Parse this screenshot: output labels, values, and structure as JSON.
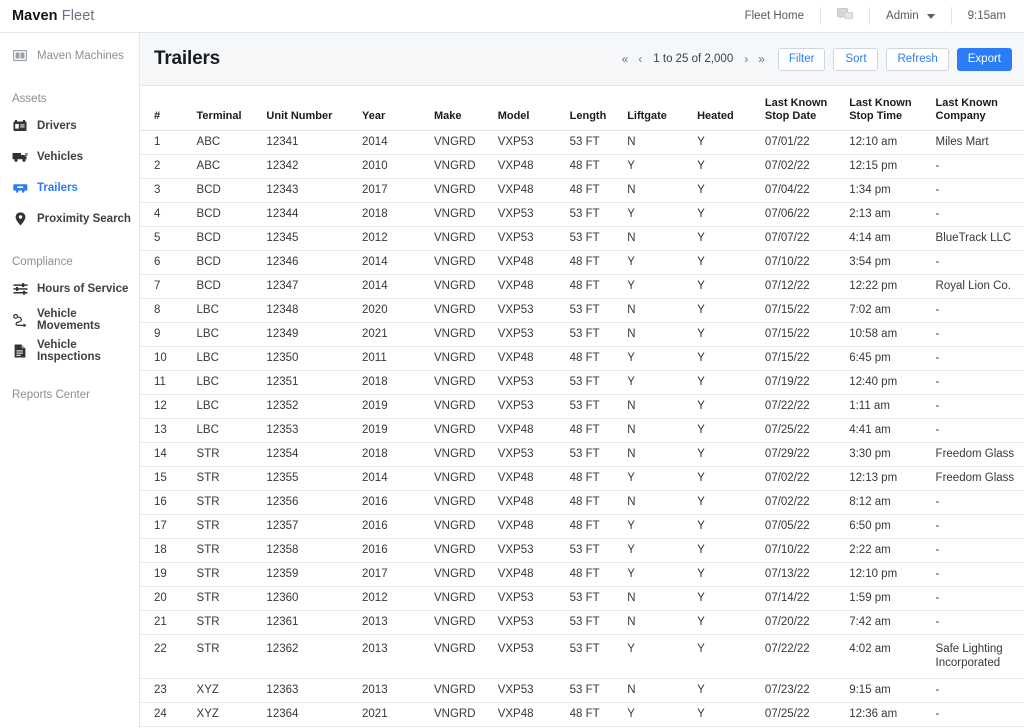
{
  "topbar": {
    "brand_bold": "Maven",
    "brand_rest": " Fleet",
    "fleet_home": "Fleet Home",
    "chat_icon": "chat-icon",
    "admin": "Admin",
    "time": "9:15am"
  },
  "sidebar": {
    "app_link": {
      "label": "Maven Machines",
      "icon": "monitor-icon"
    },
    "sections": [
      {
        "label": "Assets",
        "items": [
          {
            "label": "Drivers",
            "icon": "id-card-icon",
            "active": false
          },
          {
            "label": "Vehicles",
            "icon": "truck-icon",
            "active": false
          },
          {
            "label": "Trailers",
            "icon": "trailer-icon",
            "active": true
          },
          {
            "label": "Proximity Search",
            "icon": "map-pin-icon",
            "active": false
          }
        ]
      },
      {
        "label": "Compliance",
        "items": [
          {
            "label": "Hours of Service",
            "icon": "sliders-icon",
            "active": false
          },
          {
            "label": "Vehicle Movements",
            "icon": "route-icon",
            "active": false
          },
          {
            "label": "Vehicle Inspections",
            "icon": "document-icon",
            "active": false
          }
        ]
      }
    ],
    "reports_center": "Reports Center"
  },
  "page": {
    "title": "Trailers"
  },
  "toolbar": {
    "first_page_icon": "«",
    "prev_page_icon": "‹",
    "range_label": "1 to 25 of 2,000",
    "next_page_icon": "›",
    "last_page_icon": "»",
    "filter_label": "Filter",
    "sort_label": "Sort",
    "refresh_label": "Refresh",
    "export_label": "Export"
  },
  "colors": {
    "accent": "#2b7df5",
    "header_bg": "#f6f7f9",
    "border": "#e3e6ea"
  },
  "table": {
    "columns": [
      {
        "label": "#",
        "line1": "#",
        "line2": ""
      },
      {
        "label": "Terminal",
        "line1": "Terminal",
        "line2": ""
      },
      {
        "label": "Unit Number",
        "line1": "Unit Number",
        "line2": ""
      },
      {
        "label": "Year",
        "line1": "Year",
        "line2": ""
      },
      {
        "label": "Make",
        "line1": "Make",
        "line2": ""
      },
      {
        "label": "Model",
        "line1": "Model",
        "line2": ""
      },
      {
        "label": "Length",
        "line1": "Length",
        "line2": ""
      },
      {
        "label": "Liftgate",
        "line1": "Liftgate",
        "line2": ""
      },
      {
        "label": "Heated",
        "line1": "Heated",
        "line2": ""
      },
      {
        "label": "Last Known Stop Date",
        "line1": "Last Known",
        "line2": "Stop Date"
      },
      {
        "label": "Last Known Stop Time",
        "line1": "Last Known",
        "line2": "Stop Time"
      },
      {
        "label": "Last Known Company",
        "line1": "Last Known",
        "line2": "Company"
      }
    ],
    "rows": [
      {
        "num": "1",
        "terminal": "ABC",
        "unit": "12341",
        "year": "2014",
        "make": "VNGRD",
        "model": "VXP53",
        "length": "53 FT",
        "liftgate": "N",
        "heated": "Y",
        "stop_date": "07/01/22",
        "stop_time": "12:10 am",
        "company": "Miles Mart",
        "tall": false
      },
      {
        "num": "2",
        "terminal": "ABC",
        "unit": "12342",
        "year": "2010",
        "make": "VNGRD",
        "model": "VXP48",
        "length": "48 FT",
        "liftgate": "Y",
        "heated": "Y",
        "stop_date": "07/02/22",
        "stop_time": "12:15 pm",
        "company": "-",
        "tall": false
      },
      {
        "num": "3",
        "terminal": "BCD",
        "unit": "12343",
        "year": "2017",
        "make": "VNGRD",
        "model": "VXP48",
        "length": "48 FT",
        "liftgate": "N",
        "heated": "Y",
        "stop_date": "07/04/22",
        "stop_time": "1:34 pm",
        "company": "-",
        "tall": false
      },
      {
        "num": "4",
        "terminal": "BCD",
        "unit": "12344",
        "year": "2018",
        "make": "VNGRD",
        "model": "VXP53",
        "length": "53 FT",
        "liftgate": "Y",
        "heated": "Y",
        "stop_date": "07/06/22",
        "stop_time": "2:13 am",
        "company": "-",
        "tall": false
      },
      {
        "num": "5",
        "terminal": "BCD",
        "unit": "12345",
        "year": "2012",
        "make": "VNGRD",
        "model": "VXP53",
        "length": "53 FT",
        "liftgate": "N",
        "heated": "Y",
        "stop_date": "07/07/22",
        "stop_time": "4:14 am",
        "company": "BlueTrack LLC",
        "tall": false
      },
      {
        "num": "6",
        "terminal": "BCD",
        "unit": "12346",
        "year": "2014",
        "make": "VNGRD",
        "model": "VXP48",
        "length": "48 FT",
        "liftgate": "Y",
        "heated": "Y",
        "stop_date": "07/10/22",
        "stop_time": "3:54 pm",
        "company": "-",
        "tall": false
      },
      {
        "num": "7",
        "terminal": "BCD",
        "unit": "12347",
        "year": "2014",
        "make": "VNGRD",
        "model": "VXP48",
        "length": "48 FT",
        "liftgate": "Y",
        "heated": "Y",
        "stop_date": "07/12/22",
        "stop_time": "12:22 pm",
        "company": "Royal Lion Co.",
        "tall": false
      },
      {
        "num": "8",
        "terminal": "LBC",
        "unit": "12348",
        "year": "2020",
        "make": "VNGRD",
        "model": "VXP53",
        "length": "53 FT",
        "liftgate": "N",
        "heated": "Y",
        "stop_date": "07/15/22",
        "stop_time": "7:02 am",
        "company": "-",
        "tall": false
      },
      {
        "num": "9",
        "terminal": "LBC",
        "unit": "12349",
        "year": "2021",
        "make": "VNGRD",
        "model": "VXP53",
        "length": "53 FT",
        "liftgate": "N",
        "heated": "Y",
        "stop_date": "07/15/22",
        "stop_time": "10:58 am",
        "company": "-",
        "tall": false
      },
      {
        "num": "10",
        "terminal": "LBC",
        "unit": "12350",
        "year": "2011",
        "make": "VNGRD",
        "model": "VXP48",
        "length": "48 FT",
        "liftgate": "Y",
        "heated": "Y",
        "stop_date": "07/15/22",
        "stop_time": "6:45 pm",
        "company": "-",
        "tall": false
      },
      {
        "num": "11",
        "terminal": "LBC",
        "unit": "12351",
        "year": "2018",
        "make": "VNGRD",
        "model": "VXP53",
        "length": "53 FT",
        "liftgate": "Y",
        "heated": "Y",
        "stop_date": "07/19/22",
        "stop_time": "12:40 pm",
        "company": "-",
        "tall": false
      },
      {
        "num": "12",
        "terminal": "LBC",
        "unit": "12352",
        "year": "2019",
        "make": "VNGRD",
        "model": "VXP53",
        "length": "53 FT",
        "liftgate": "N",
        "heated": "Y",
        "stop_date": "07/22/22",
        "stop_time": "1:11 am",
        "company": "-",
        "tall": false
      },
      {
        "num": "13",
        "terminal": "LBC",
        "unit": "12353",
        "year": "2019",
        "make": "VNGRD",
        "model": "VXP48",
        "length": "48 FT",
        "liftgate": "N",
        "heated": "Y",
        "stop_date": "07/25/22",
        "stop_time": "4:41 am",
        "company": "-",
        "tall": false
      },
      {
        "num": "14",
        "terminal": "STR",
        "unit": "12354",
        "year": "2018",
        "make": "VNGRD",
        "model": "VXP53",
        "length": "53 FT",
        "liftgate": "N",
        "heated": "Y",
        "stop_date": "07/29/22",
        "stop_time": "3:30 pm",
        "company": "Freedom Glass",
        "tall": false
      },
      {
        "num": "15",
        "terminal": "STR",
        "unit": "12355",
        "year": "2014",
        "make": "VNGRD",
        "model": "VXP48",
        "length": "48 FT",
        "liftgate": "Y",
        "heated": "Y",
        "stop_date": "07/02/22",
        "stop_time": "12:13 pm",
        "company": "Freedom Glass",
        "tall": false
      },
      {
        "num": "16",
        "terminal": "STR",
        "unit": "12356",
        "year": "2016",
        "make": "VNGRD",
        "model": "VXP48",
        "length": "48 FT",
        "liftgate": "N",
        "heated": "Y",
        "stop_date": "07/02/22",
        "stop_time": "8:12 am",
        "company": "-",
        "tall": false
      },
      {
        "num": "17",
        "terminal": "STR",
        "unit": "12357",
        "year": "2016",
        "make": "VNGRD",
        "model": "VXP48",
        "length": "48 FT",
        "liftgate": "Y",
        "heated": "Y",
        "stop_date": "07/05/22",
        "stop_time": "6:50 pm",
        "company": "-",
        "tall": false
      },
      {
        "num": "18",
        "terminal": "STR",
        "unit": "12358",
        "year": "2016",
        "make": "VNGRD",
        "model": "VXP53",
        "length": "53 FT",
        "liftgate": "Y",
        "heated": "Y",
        "stop_date": "07/10/22",
        "stop_time": "2:22 am",
        "company": "-",
        "tall": false
      },
      {
        "num": "19",
        "terminal": "STR",
        "unit": "12359",
        "year": "2017",
        "make": "VNGRD",
        "model": "VXP48",
        "length": "48 FT",
        "liftgate": "Y",
        "heated": "Y",
        "stop_date": "07/13/22",
        "stop_time": "12:10 pm",
        "company": "-",
        "tall": false
      },
      {
        "num": "20",
        "terminal": "STR",
        "unit": "12360",
        "year": "2012",
        "make": "VNGRD",
        "model": "VXP53",
        "length": "53 FT",
        "liftgate": "N",
        "heated": "Y",
        "stop_date": "07/14/22",
        "stop_time": "1:59 pm",
        "company": "-",
        "tall": false
      },
      {
        "num": "21",
        "terminal": "STR",
        "unit": "12361",
        "year": "2013",
        "make": "VNGRD",
        "model": "VXP53",
        "length": "53 FT",
        "liftgate": "N",
        "heated": "Y",
        "stop_date": "07/20/22",
        "stop_time": "7:42 am",
        "company": "-",
        "tall": false
      },
      {
        "num": "22",
        "terminal": "STR",
        "unit": "12362",
        "year": "2013",
        "make": "VNGRD",
        "model": "VXP53",
        "length": "53 FT",
        "liftgate": "Y",
        "heated": "Y",
        "stop_date": "07/22/22",
        "stop_time": "4:02 am",
        "company": "Safe Lighting Incorporated",
        "tall": true
      },
      {
        "num": "23",
        "terminal": "XYZ",
        "unit": "12363",
        "year": "2013",
        "make": "VNGRD",
        "model": "VXP53",
        "length": "53 FT",
        "liftgate": "N",
        "heated": "Y",
        "stop_date": "07/23/22",
        "stop_time": "9:15 am",
        "company": "-",
        "tall": false
      },
      {
        "num": "24",
        "terminal": "XYZ",
        "unit": "12364",
        "year": "2021",
        "make": "VNGRD",
        "model": "VXP48",
        "length": "48 FT",
        "liftgate": "Y",
        "heated": "Y",
        "stop_date": "07/25/22",
        "stop_time": "12:36 am",
        "company": "-",
        "tall": false
      }
    ]
  }
}
